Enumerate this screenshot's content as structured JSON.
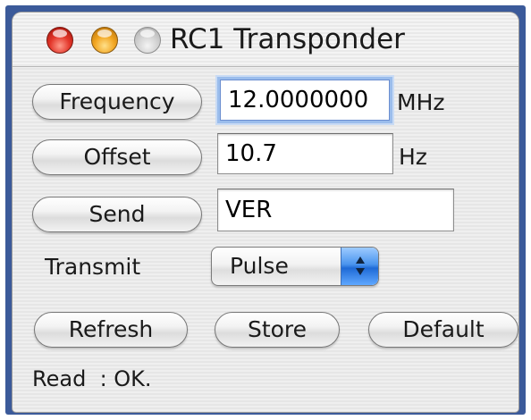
{
  "window": {
    "title": "RC1 Transponder"
  },
  "frequency": {
    "button_label": "Frequency",
    "value": "12.0000000",
    "unit": "MHz"
  },
  "offset": {
    "button_label": "Offset",
    "value": "10.7",
    "unit": "Hz"
  },
  "send": {
    "button_label": "Send",
    "value": "VER"
  },
  "transmit": {
    "label": "Transmit",
    "selected": "Pulse"
  },
  "actions": {
    "refresh_label": "Refresh",
    "store_label": "Store",
    "default_label": "Default"
  },
  "status": {
    "text": "Read  : OK."
  },
  "colors": {
    "close": "#e3362a",
    "minimize": "#f2a622",
    "zoom_disabled": "#cfcfcf",
    "focus_ring": "#9bbdec",
    "popup_accent": "#4a94ee",
    "desktop_frame": "#3b5a9a"
  },
  "icons": [
    "close-icon",
    "minimize-icon",
    "zoom-icon",
    "up-down-arrows-icon"
  ]
}
